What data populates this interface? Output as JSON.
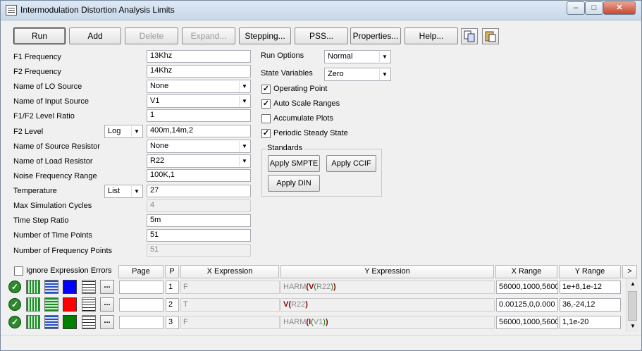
{
  "window": {
    "title": "Intermodulation Distortion Analysis Limits"
  },
  "toolbar": {
    "run": "Run",
    "add": "Add",
    "delete": "Delete",
    "expand": "Expand...",
    "stepping": "Stepping...",
    "pss": "PSS...",
    "properties": "Properties...",
    "help": "Help..."
  },
  "fields": [
    {
      "label": "F1 Frequency",
      "value": "13Khz"
    },
    {
      "label": "F2 Frequency",
      "value": "14Khz"
    },
    {
      "label": "Name of LO Source",
      "value": "None"
    },
    {
      "label": "Name of Input Source",
      "value": "V1"
    },
    {
      "label": "F1/F2 Level Ratio",
      "value": "1"
    },
    {
      "label": "F2 Level",
      "value": "400m,14m,2",
      "mode": "Log"
    },
    {
      "label": "Name of Source Resistor",
      "value": "None"
    },
    {
      "label": "Name of Load Resistor",
      "value": "R22"
    },
    {
      "label": "Noise Frequency Range",
      "value": "100K,1"
    },
    {
      "label": "Temperature",
      "value": "27",
      "mode": "List"
    },
    {
      "label": "Max Simulation Cycles",
      "value": "4"
    },
    {
      "label": "Time Step Ratio",
      "value": "5m"
    },
    {
      "label": "Number of Time Points",
      "value": "51"
    },
    {
      "label": "Number of Frequency Points",
      "value": "51"
    }
  ],
  "options": {
    "run_options_label": "Run Options",
    "run_options_value": "Normal",
    "state_variables_label": "State Variables",
    "state_variables_value": "Zero",
    "checks": [
      {
        "label": "Operating Point",
        "checked": true
      },
      {
        "label": "Auto Scale Ranges",
        "checked": true
      },
      {
        "label": "Accumulate Plots",
        "checked": false
      },
      {
        "label": "Periodic Steady State",
        "checked": true
      }
    ]
  },
  "standards": {
    "legend": "Standards",
    "smpte": "Apply SMPTE",
    "ccif": "Apply CCIF",
    "din": "Apply DIN"
  },
  "grid": {
    "ignore_label": "Ignore Expression Errors",
    "headers": {
      "page": "Page",
      "p": "P",
      "x": "X Expression",
      "y": "Y Expression",
      "xr": "X Range",
      "yr": "Y Range",
      "more": ">"
    },
    "rows": [
      {
        "p": "1",
        "x": "F",
        "y_fn": "HARM",
        "y_inner_fn": "V",
        "y_arg": "R22",
        "xr": "56000,1000,5600",
        "yr": "1e+8,1e-12",
        "color": "#0000ff"
      },
      {
        "p": "2",
        "x": "T",
        "y_fn": "",
        "y_inner_fn": "V",
        "y_arg": "R22",
        "xr": "0.00125,0,0.000",
        "yr": "36,-24,12",
        "color": "#ff0000"
      },
      {
        "p": "3",
        "x": "F",
        "y_fn": "HARM",
        "y_inner_fn": "I",
        "y_arg": "V1",
        "xr": "56000,1000,5600",
        "yr": "1,1e-20",
        "color": "#008000"
      }
    ]
  }
}
